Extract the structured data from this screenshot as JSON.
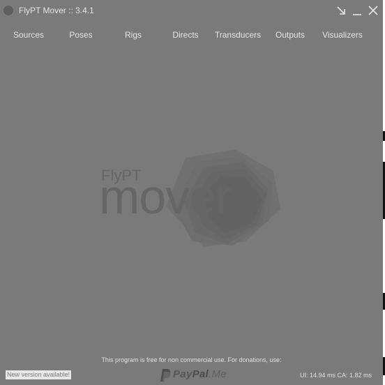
{
  "window": {
    "title": "FlyPT Mover :: 3.4.1",
    "buttons": [
      "restore-down",
      "minimize",
      "close"
    ]
  },
  "menu": {
    "items": [
      {
        "label": "Sources"
      },
      {
        "label": "Poses"
      },
      {
        "label": "Rigs"
      },
      {
        "label": "Directs"
      },
      {
        "label": "Transducers"
      },
      {
        "label": "Outputs"
      },
      {
        "label": "Visualizers"
      }
    ]
  },
  "logo": {
    "small_text": "FlyPT",
    "large_text": "mover"
  },
  "footer": {
    "donation_note": "This program is free for non commercial use. For donations, use:",
    "new_version": "New version available!",
    "paypal_pay": "Pay",
    "paypal_pal": "Pal",
    "paypal_me": ".Me",
    "timings": "UI: 14.94 ms   CA: 1.82 ms"
  },
  "colors": {
    "background": "#7a7a7a",
    "text": "#e4e4e4",
    "logo_shade": "#656565"
  },
  "icons": {
    "app": "app-logo-icon",
    "restore": "restore-arrow-icon",
    "minimize": "minimize-icon",
    "close": "close-icon",
    "paypal": "paypal-icon"
  }
}
